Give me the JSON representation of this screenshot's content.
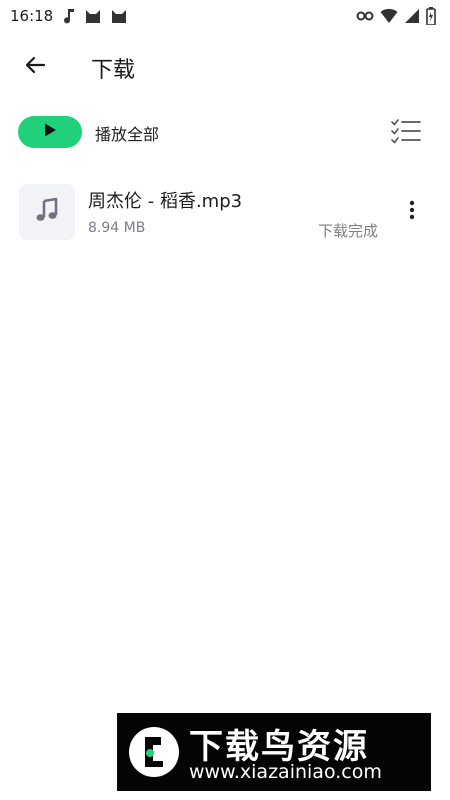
{
  "status_bar": {
    "time": "16:18",
    "notification_icons": [
      "music-note-icon",
      "cat-icon",
      "cat-icon"
    ],
    "system_icons": [
      "vpn-key-icon",
      "wifi-icon",
      "signal-icon",
      "battery-icon"
    ]
  },
  "header": {
    "title": "下载",
    "back_icon": "arrow-left-icon"
  },
  "toolbar": {
    "play_all_label": "播放全部",
    "play_icon": "play-icon",
    "multi_select_icon": "checklist-icon",
    "accent_color": "#21d07b"
  },
  "downloads": [
    {
      "title": "周杰伦 - 稻香.mp3",
      "size": "8.94 MB",
      "status": "下载完成",
      "thumb_icon": "music-note-icon",
      "more_icon": "more-vertical-icon"
    }
  ],
  "watermark": {
    "name": "下载鸟资源",
    "url": "www.xiazainiao.com"
  }
}
